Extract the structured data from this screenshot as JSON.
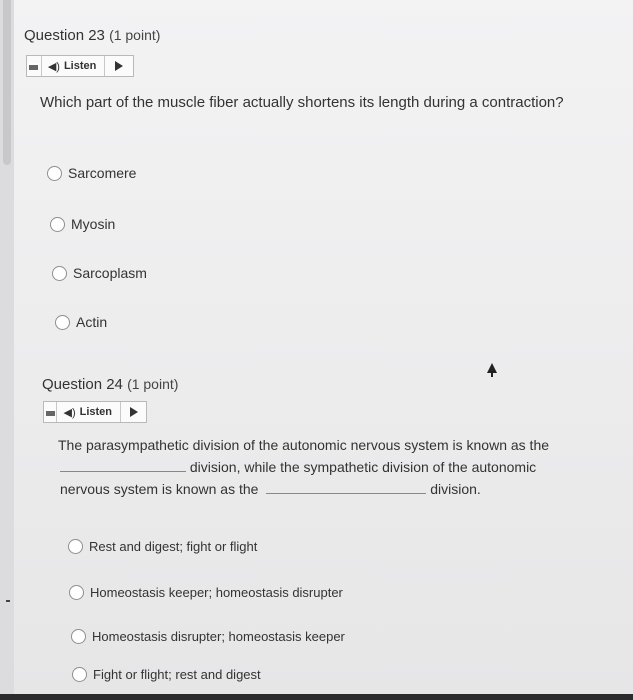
{
  "q23": {
    "title": "Question 23",
    "points": "(1 point)",
    "listen_label": "Listen",
    "prompt": "Which part of the muscle fiber actually shortens its length during a contraction?",
    "options": [
      "Sarcomere",
      "Myosin",
      "Sarcoplasm",
      "Actin"
    ]
  },
  "q24": {
    "title": "Question 24",
    "points": "(1 point)",
    "listen_label": "Listen",
    "prompt_line1": "The parasympathetic division of the autonomic nervous system is known as the",
    "prompt_line2": "division, while the sympathetic division of the autonomic",
    "prompt_line3": "nervous system is known as the",
    "prompt_line3_end": "division.",
    "options": [
      "Rest and digest; fight or flight",
      "Homeostasis keeper; homeostasis disrupter",
      "Homeostasis disrupter; homeostasis keeper",
      "Fight or flight; rest and digest"
    ]
  }
}
